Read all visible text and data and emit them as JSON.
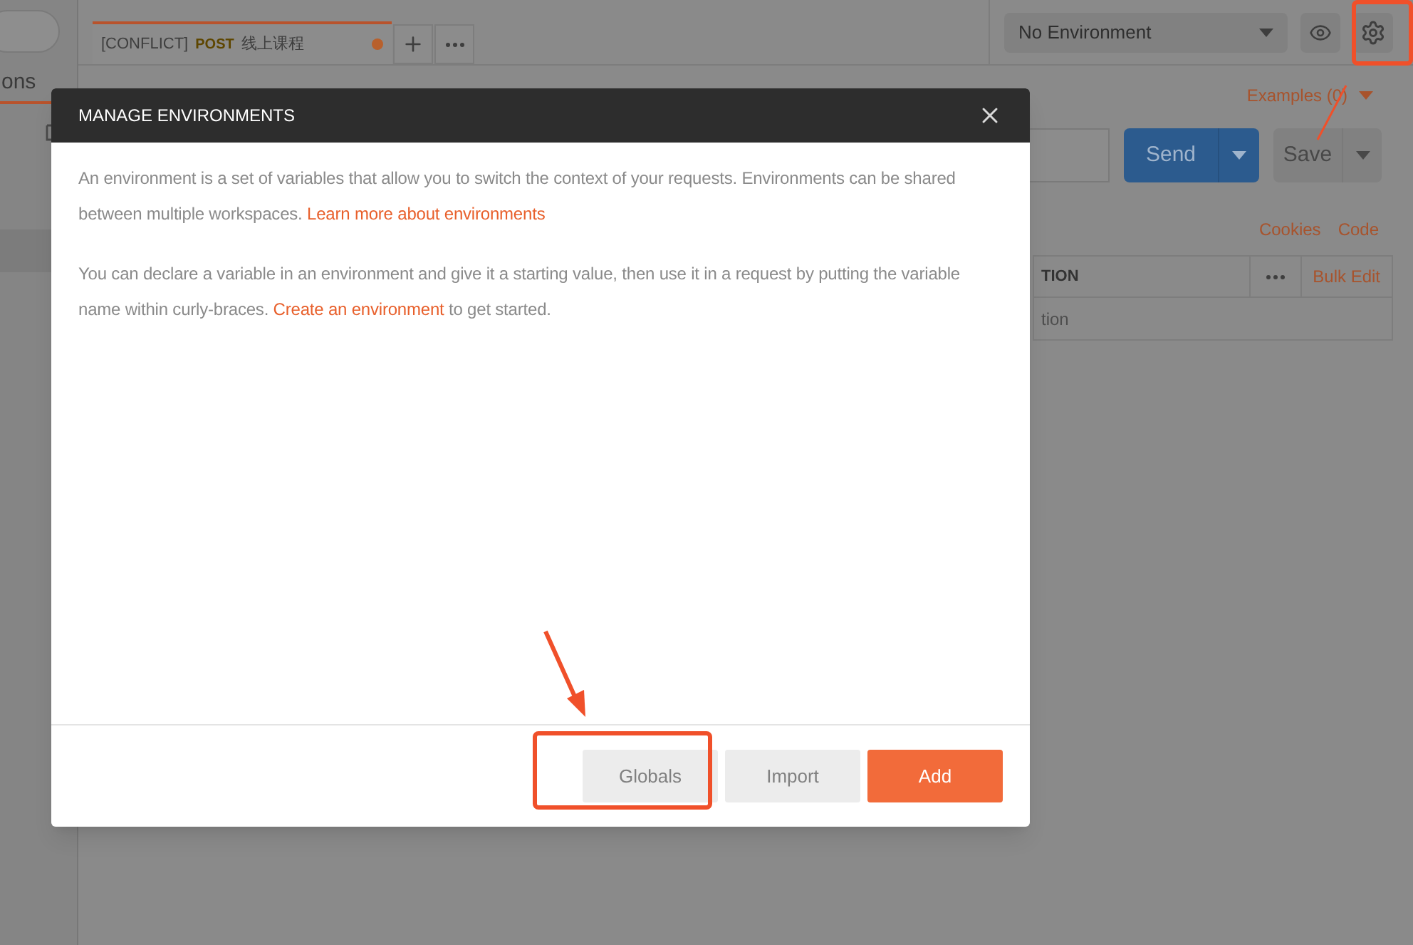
{
  "sidebar": {
    "tab_label": "ons",
    "selected": true
  },
  "request_tab": {
    "tag": "[CONFLICT]",
    "method": "POST",
    "name": "线上课程",
    "unsaved": true
  },
  "environment_select": {
    "value": "No Environment"
  },
  "examples": "Examples (0)",
  "send": "Send",
  "save": "Save",
  "links": [
    "Cookies",
    "Code"
  ],
  "params": {
    "column_1": "TION",
    "bulk_edit": "Bulk Edit",
    "placeholder": "tion"
  },
  "modal": {
    "title": "MANAGE ENVIRONMENTS",
    "paragraphs": [
      {
        "before": "An environment is a set of variables that allow you to switch the context of your requests. Environments can be shared between multiple workspaces. ",
        "link": "Learn more about environments"
      },
      {
        "before": "You can declare a variable in an environment and give it a starting value, then use it in a request by putting the variable name within curly-braces. ",
        "link": "Create an environment",
        "after": " to get started."
      }
    ],
    "buttons": [
      {
        "label": "Globals",
        "kind": "secondary"
      },
      {
        "label": "Import",
        "kind": "secondary"
      },
      {
        "label": "Add",
        "kind": "primary"
      }
    ]
  }
}
